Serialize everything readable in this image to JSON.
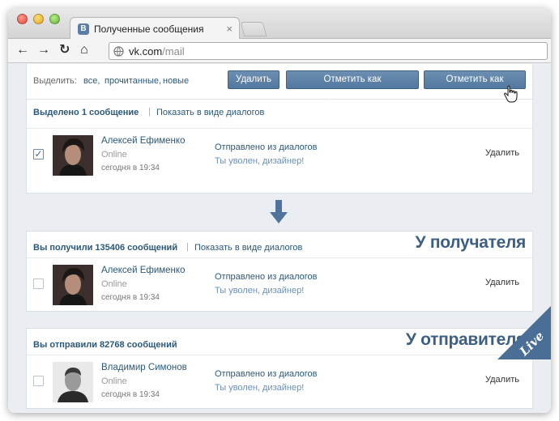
{
  "browser": {
    "tab_title": "Полученные сообщения",
    "tab_favicon": "В",
    "tab_close": "×",
    "url_host": "vk.com",
    "url_path": "/mail",
    "nav_icons": {
      "back": "←",
      "forward": "→",
      "reload": "↻",
      "home": "⌂"
    }
  },
  "selection_bar": {
    "label": "Выделить:",
    "links": [
      "все,",
      "прочитанные,",
      "новые"
    ],
    "buttons": {
      "delete": "Удалить",
      "mark_read": "Отметить как прочитанные",
      "mark_new": "Отметить как новые"
    }
  },
  "top_panel": {
    "selected_text": "Выделено 1 сообщение",
    "separator": "|",
    "dialogs_link": "Показать в виде диалогов",
    "message": {
      "name": "Алексей Ефименко",
      "status": "Online",
      "date": "сегодня в 19:34",
      "subject": "Отправлено из диалогов",
      "preview": "Ты уволен, дизайнер!",
      "delete": "Удалить",
      "checked": true,
      "check_mark": "✓"
    }
  },
  "recipient_panel": {
    "big_title": "У получателя",
    "head_text": "Вы получили 135406 сообщений",
    "separator": "|",
    "dialogs_link": "Показать в виде диалогов",
    "message": {
      "name": "Алексей Ефименко",
      "status": "Online",
      "date": "сегодня в 19:34",
      "subject": "Отправлено из диалогов",
      "preview": "Ты уволен, дизайнер!",
      "delete": "Удалить"
    }
  },
  "sender_panel": {
    "big_title": "У отправителя",
    "head_text": "Вы отправили 82768 сообщений",
    "message": {
      "name": "Владимир Симонов",
      "status": "Online",
      "date": "сегодня в 19:34",
      "subject": "Отправлено из диалогов",
      "preview": "Ты уволен, дизайнер!",
      "delete": "Удалить"
    }
  },
  "badge": {
    "text": "Live"
  },
  "colors": {
    "link": "#2b587a",
    "button": "#5d82a9",
    "badge": "#4a6e96",
    "background": "#eaeef2"
  }
}
